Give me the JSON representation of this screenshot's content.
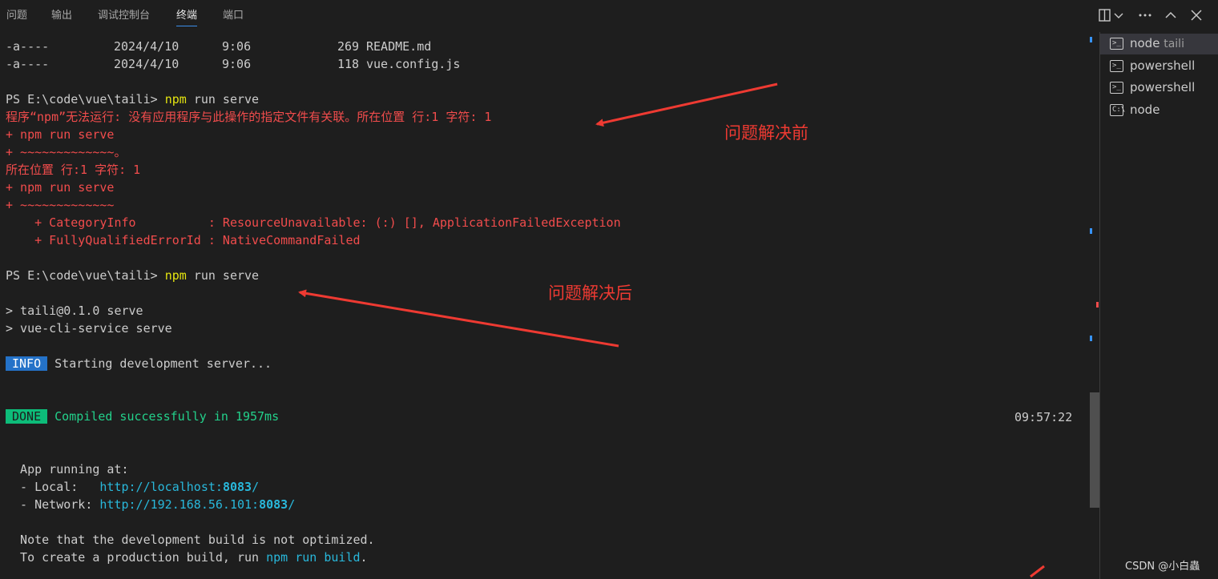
{
  "tabs": [
    {
      "label": "问题"
    },
    {
      "label": "输出"
    },
    {
      "label": "调试控制台"
    },
    {
      "label": "终端"
    },
    {
      "label": "端口"
    }
  ],
  "terminal": {
    "files": [
      {
        "mode": "-a----",
        "date": "2024/4/10",
        "time": "9:06",
        "size": "269",
        "name": "README.md"
      },
      {
        "mode": "-a----",
        "date": "2024/4/10",
        "time": "9:06",
        "size": "118",
        "name": "vue.config.js"
      }
    ],
    "prompt1": "PS E:\\code\\vue\\taili>",
    "cmd_npm": "npm",
    "cmd_rest": "run serve",
    "err": [
      "程序“npm”无法运行: 没有应用程序与此操作的指定文件有关联。所在位置 行:1 字符: 1",
      "+ npm run serve",
      "+ ~~~~~~~~~~~~~。",
      "所在位置 行:1 字符: 1",
      "+ npm run serve",
      "+ ~~~~~~~~~~~~~",
      "    + CategoryInfo          : ResourceUnavailable: (:) [], ApplicationFailedException",
      "    + FullyQualifiedErrorId : NativeCommandFailed"
    ],
    "prompt2": "PS E:\\code\\vue\\taili>",
    "out1": "> taili@0.1.0 serve",
    "out2": "> vue-cli-service serve",
    "info_badge": "INFO",
    "info_text": "Starting development server...",
    "done_badge": "DONE",
    "done_text": "Compiled successfully in 1957ms",
    "done_time": "09:57:22",
    "app_running": "  App running at:",
    "local_label": "  - Local:   ",
    "local_url_pre": "http://localhost:",
    "local_port": "8083",
    "local_url_post": "/",
    "network_label": "  - Network: ",
    "network_url_pre": "http://192.168.56.101:",
    "network_port": "8083",
    "network_url_post": "/",
    "note1": "  Note that the development build is not optimized.",
    "note2_pre": "  To create a production build, run ",
    "note2_cmd": "npm run build",
    "note2_post": "."
  },
  "annotations": {
    "before": "问题解决前",
    "after": "问题解决后"
  },
  "panel": {
    "items": [
      {
        "label": "node",
        "sub": "taili",
        "icon": "terminal-icon"
      },
      {
        "label": "powershell",
        "icon": "terminal-icon"
      },
      {
        "label": "powershell",
        "icon": "terminal-icon"
      },
      {
        "label": "node",
        "icon": "cmd-icon"
      }
    ]
  },
  "watermark": "CSDN @小白蟲",
  "colors": {
    "background": "#1e1e1e",
    "error": "#f14c4c",
    "info": "#2472c8",
    "done": "#0dbc79",
    "link": "#3b8eea",
    "annotation": "#ee3a32"
  }
}
